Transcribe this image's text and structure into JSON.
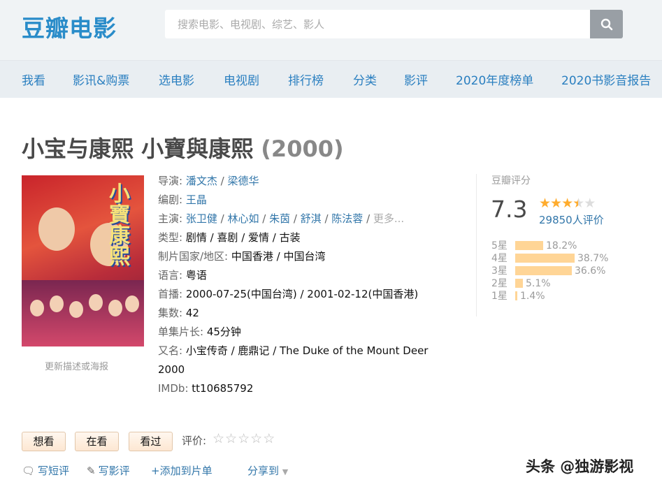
{
  "header": {
    "logo": "豆瓣电影",
    "search_placeholder": "搜索电影、电视剧、综艺、影人",
    "search_icon": "search-icon"
  },
  "nav": {
    "items": [
      "我看",
      "影讯&购票",
      "选电影",
      "电视剧",
      "排行榜",
      "分类",
      "影评",
      "2020年度榜单",
      "2020书影音报告"
    ]
  },
  "movie": {
    "title": "小宝与康熙 小寶與康熙",
    "year": "(2000)",
    "poster_link": "更新描述或海报",
    "director_label": "导演:",
    "directors": [
      "潘文杰",
      "梁德华"
    ],
    "writer_label": "编剧:",
    "writers": [
      "王晶"
    ],
    "cast_label": "主演:",
    "cast": [
      "张卫健",
      "林心如",
      "朱茵",
      "舒淇",
      "陈法蓉"
    ],
    "cast_more": "更多...",
    "genre_label": "类型:",
    "genres": "剧情 / 喜剧 / 爱情 / 古装",
    "region_label": "制片国家/地区:",
    "region": "中国香港 / 中国台湾",
    "language_label": "语言:",
    "language": "粤语",
    "premiere_label": "首播:",
    "premiere": "2000-07-25(中国台湾) / 2001-02-12(中国香港)",
    "episodes_label": "集数:",
    "episodes": "42",
    "runtime_label": "单集片长:",
    "runtime": "45分钟",
    "aka_label": "又名:",
    "aka": "小宝传奇 / 鹿鼎记 / The Duke of the Mount Deer",
    "aka_line2": "2000",
    "imdb_label": "IMDb:",
    "imdb": "tt10685792"
  },
  "rating": {
    "label": "豆瓣评分",
    "score": "7.3",
    "stars": 3.5,
    "votes": "29850人评价",
    "distribution": [
      {
        "label": "5星",
        "percent": 18.2,
        "text": "18.2%"
      },
      {
        "label": "4星",
        "percent": 38.7,
        "text": "38.7%"
      },
      {
        "label": "3星",
        "percent": 36.6,
        "text": "36.6%"
      },
      {
        "label": "2星",
        "percent": 5.1,
        "text": "5.1%"
      },
      {
        "label": "1星",
        "percent": 1.4,
        "text": "1.4%"
      }
    ],
    "bar_color": "#ffd596"
  },
  "actions": {
    "want": "想看",
    "watching": "在看",
    "watched": "看过",
    "rate_label": "评价:",
    "write_short": "写短评",
    "write_review": "写影评",
    "add_to_list": "+添加到片单",
    "share": "分享到"
  },
  "watermark": "头条 @独游影视",
  "colors": {
    "brand": "#2a8cc9",
    "link": "#3377aa",
    "star": "#ffac2d"
  }
}
